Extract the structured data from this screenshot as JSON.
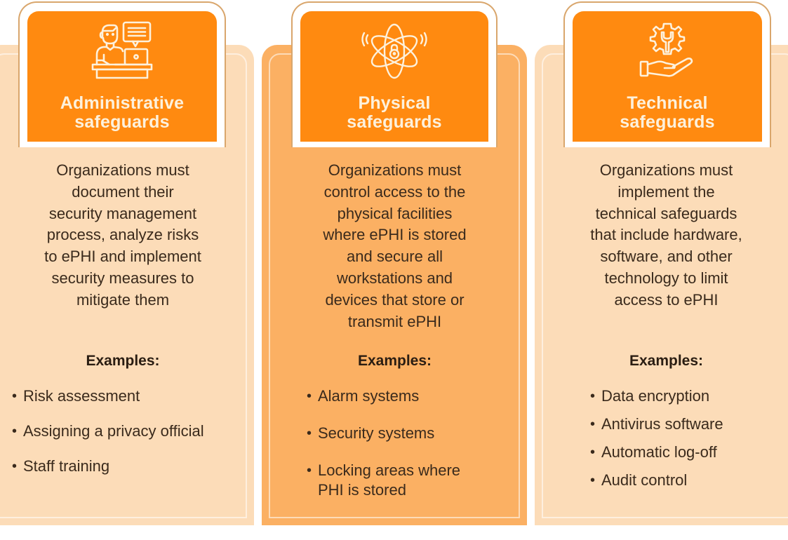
{
  "colors": {
    "header_orange": "#ff8a10",
    "card_light": "#fcdcb8",
    "card_dark": "#fbb063",
    "header_text": "#fdf1dc",
    "body_text": "#3a2a1c"
  },
  "columns": [
    {
      "icon": "person-at-laptop-with-chat-bubble-icon",
      "title": "Administrative\nsafeguards",
      "title_line1": "Administrative",
      "title_line2": "safeguards",
      "description": "Organizations must\ndocument their\nsecurity management\nprocess, analyze risks\nto ePHI and implement\nsecurity measures to\nmitigate them",
      "examples_heading": "Examples:",
      "examples": [
        "Risk assessment",
        "Assigning a privacy official",
        "Staff training"
      ]
    },
    {
      "icon": "atom-with-lock-icon",
      "title": "Physical\nsafeguards",
      "title_line1": "Physical",
      "title_line2": "safeguards",
      "description": "Organizations must\ncontrol access to the\nphysical facilities\nwhere ePHI is stored\nand secure all\nworkstations and\ndevices that store or\ntransmit ePHI",
      "examples_heading": "Examples:",
      "examples": [
        "Alarm systems",
        "Security systems",
        "Locking areas where\nPHI is stored"
      ]
    },
    {
      "icon": "hand-holding-gear-wrench-icon",
      "title": "Technical\nsafeguards",
      "title_line1": "Technical",
      "title_line2": "safeguards",
      "description": "Organizations must\nimplement the\ntechnical safeguards\nthat include hardware,\nsoftware, and other\ntechnology to limit\naccess to ePHI",
      "examples_heading": "Examples:",
      "examples": [
        "Data encryption",
        "Antivirus software",
        "Automatic log-off",
        "Audit control"
      ]
    }
  ]
}
